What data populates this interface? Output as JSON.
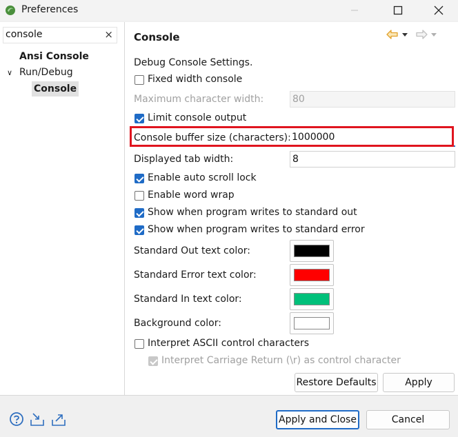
{
  "window": {
    "title": "Preferences"
  },
  "filter": {
    "value": "console",
    "clear_glyph": "×"
  },
  "tree": [
    {
      "label": "Ansi Console",
      "bold": true
    },
    {
      "label": "Run/Debug",
      "expander": "∨"
    },
    {
      "label": "Console",
      "bold": true,
      "selected": true
    }
  ],
  "page": {
    "title": "Console",
    "section_label": "Debug Console Settings.",
    "fixed_width": {
      "label": "Fixed width console",
      "checked": false
    },
    "max_char_width": {
      "label": "Maximum character width:",
      "value": "80",
      "enabled": false
    },
    "limit_output": {
      "label": "Limit console output",
      "checked": true
    },
    "buffer_size": {
      "label": "Console buffer size (characters):",
      "value": "1000000"
    },
    "tab_width": {
      "label": "Displayed tab width:",
      "value": "8"
    },
    "auto_scroll": {
      "label": "Enable auto scroll lock",
      "checked": true
    },
    "word_wrap": {
      "label": "Enable word wrap",
      "checked": false
    },
    "show_stdout": {
      "label": "Show when program writes to standard out",
      "checked": true
    },
    "show_stderr": {
      "label": "Show when program writes to standard error",
      "checked": true
    },
    "colors": [
      {
        "label": "Standard Out text color:",
        "color": "#000000"
      },
      {
        "label": "Standard Error text color:",
        "color": "#ff0000"
      },
      {
        "label": "Standard In text color:",
        "color": "#00c07a"
      },
      {
        "label": "Background color:",
        "color": "#ffffff"
      }
    ],
    "ascii_control": {
      "label": "Interpret ASCII control characters",
      "checked": false
    },
    "carriage_return": {
      "label": "Interpret Carriage Return (\\r) as control character",
      "checked": true,
      "enabled": false
    },
    "restore_defaults": "Restore Defaults",
    "apply": "Apply"
  },
  "footer": {
    "apply_and_close": "Apply and Close",
    "cancel": "Cancel"
  },
  "colors": {
    "accent": "#1f6bc6",
    "highlight_box": "#e0141e",
    "nav_arrow": "#e1a12c"
  }
}
